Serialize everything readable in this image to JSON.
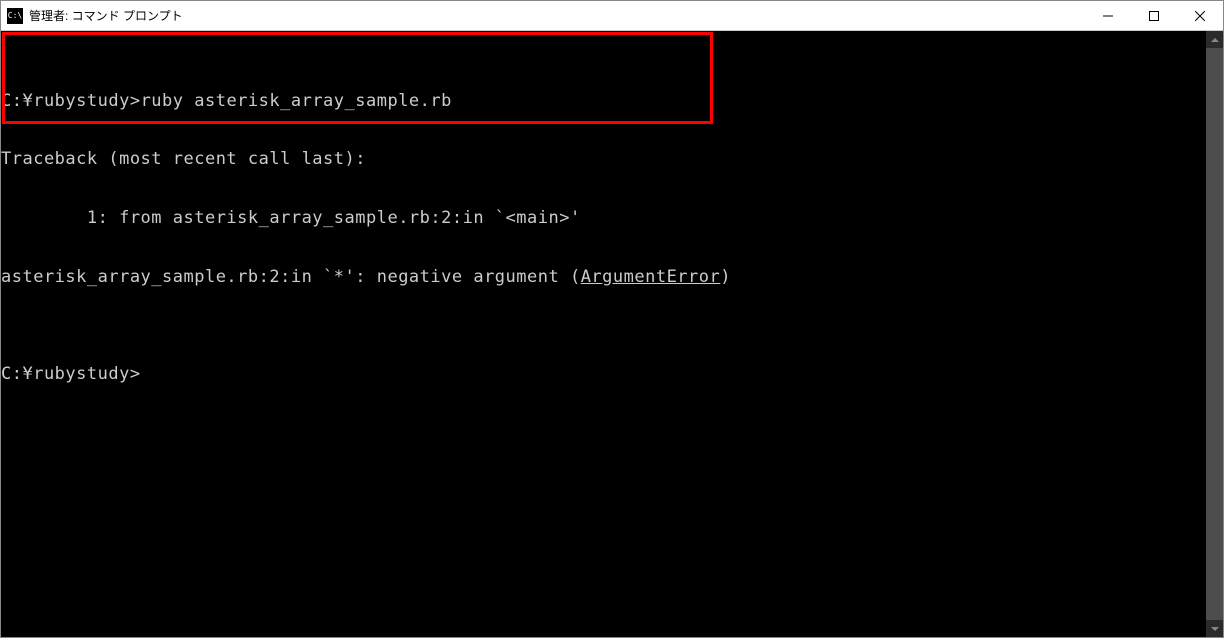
{
  "window": {
    "title": "管理者: コマンド プロンプト"
  },
  "terminal": {
    "lines": {
      "l1_prompt": "C:¥rubystudy>",
      "l1_cmd": "ruby asterisk_array_sample.rb",
      "l2": "Traceback (most recent call last):",
      "l3": "        1: from asterisk_array_sample.rb:2:in `<main>'",
      "l4_a": "asterisk_array_sample.rb:2:in `*': negative argument (",
      "l4_b": "ArgumentError",
      "l4_c": ")",
      "l5": "",
      "l6": "C:¥rubystudy>"
    }
  }
}
